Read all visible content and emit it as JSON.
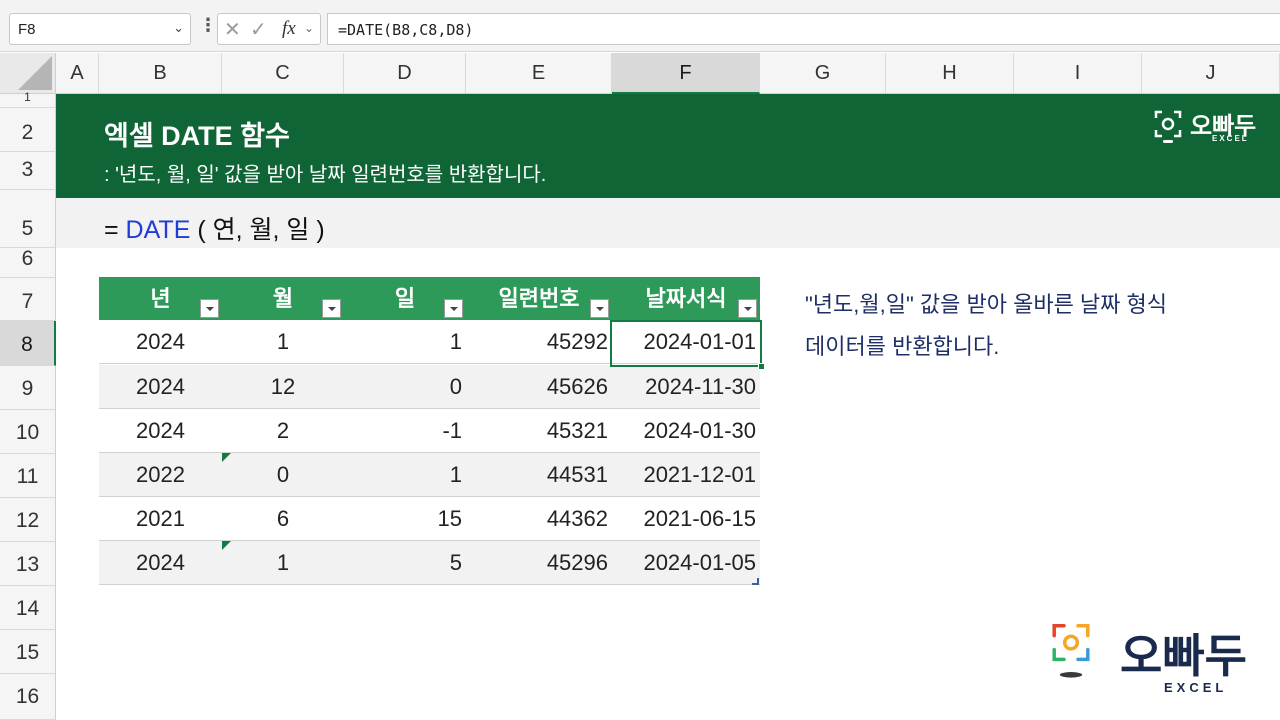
{
  "formula_bar": {
    "name_box": "F8",
    "formula": "=DATE(B8,C8,D8)",
    "fx_label": "fx"
  },
  "columns": [
    "A",
    "B",
    "C",
    "D",
    "E",
    "F",
    "G",
    "H",
    "I",
    "J"
  ],
  "selected_column": "F",
  "rows": [
    "1",
    "2",
    "3",
    "5",
    "6",
    "7",
    "8",
    "9",
    "10",
    "11",
    "12",
    "13",
    "14",
    "15",
    "16"
  ],
  "selected_row": "8",
  "banner": {
    "title": "엑셀 DATE 함수",
    "subtitle": ": '년도, 월, 일' 값을 받아 날짜 일련번호를 반환합니다.",
    "logo_text": "오빠두",
    "logo_sub": "EXCEL",
    "color": "#0f6535"
  },
  "syntax": {
    "prefix": "= ",
    "function": "DATE",
    "args": " ( 연, 월, 일 )"
  },
  "table": {
    "headers": [
      "년",
      "월",
      "일",
      "일련번호",
      "날짜서식"
    ],
    "rows": [
      [
        "2024",
        "1",
        "1",
        "45292",
        "2024-01-01"
      ],
      [
        "2024",
        "12",
        "0",
        "45626",
        "2024-11-30"
      ],
      [
        "2024",
        "2",
        "-1",
        "45321",
        "2024-01-30"
      ],
      [
        "2022",
        "0",
        "1",
        "44531",
        "2021-12-01"
      ],
      [
        "2021",
        "6",
        "15",
        "44362",
        "2021-06-15"
      ],
      [
        "2024",
        "1",
        "5",
        "45296",
        "2024-01-05"
      ]
    ],
    "header_color": "#2e9a5a"
  },
  "note": {
    "line1": "\"년도,월,일\" 값을 받아 올바른 날짜 형식",
    "line2": "데이터를 반환합니다."
  },
  "brand_logo": {
    "text": "오빠두",
    "sub": "EXCEL"
  }
}
